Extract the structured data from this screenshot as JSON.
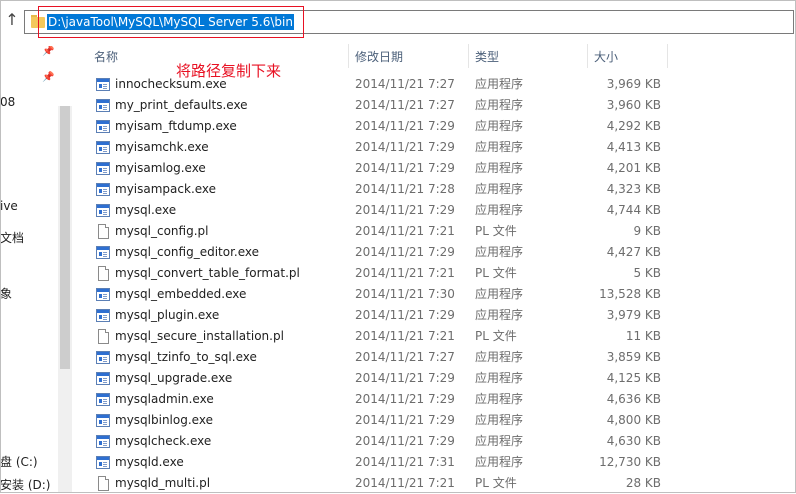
{
  "address_bar": {
    "path": "D:\\javaTool\\MySQL\\MySQL Server 5.6\\bin"
  },
  "annotation": {
    "text": "将路径复制下来",
    "color": "#e81123"
  },
  "nav_pane": {
    "items": [
      {
        "label": "08"
      },
      {
        "label": "ive"
      },
      {
        "label": "文档"
      },
      {
        "label": "象"
      },
      {
        "label": "盘 (C:)"
      },
      {
        "label": "安装 (D:)"
      }
    ]
  },
  "columns": {
    "name": "名称",
    "date": "修改日期",
    "type": "类型",
    "size": "大小"
  },
  "files": [
    {
      "name": "innochecksum.exe",
      "date": "2014/11/21 7:27",
      "type": "应用程序",
      "size": "3,969 KB",
      "icon": "exe-icon"
    },
    {
      "name": "my_print_defaults.exe",
      "date": "2014/11/21 7:27",
      "type": "应用程序",
      "size": "3,960 KB",
      "icon": "exe-icon"
    },
    {
      "name": "myisam_ftdump.exe",
      "date": "2014/11/21 7:29",
      "type": "应用程序",
      "size": "4,292 KB",
      "icon": "exe-icon"
    },
    {
      "name": "myisamchk.exe",
      "date": "2014/11/21 7:29",
      "type": "应用程序",
      "size": "4,413 KB",
      "icon": "exe-icon"
    },
    {
      "name": "myisamlog.exe",
      "date": "2014/11/21 7:29",
      "type": "应用程序",
      "size": "4,201 KB",
      "icon": "exe-icon"
    },
    {
      "name": "myisampack.exe",
      "date": "2014/11/21 7:28",
      "type": "应用程序",
      "size": "4,323 KB",
      "icon": "exe-icon"
    },
    {
      "name": "mysql.exe",
      "date": "2014/11/21 7:29",
      "type": "应用程序",
      "size": "4,744 KB",
      "icon": "exe-icon"
    },
    {
      "name": "mysql_config.pl",
      "date": "2014/11/21 7:21",
      "type": "PL 文件",
      "size": "9 KB",
      "icon": "document-icon"
    },
    {
      "name": "mysql_config_editor.exe",
      "date": "2014/11/21 7:29",
      "type": "应用程序",
      "size": "4,427 KB",
      "icon": "exe-icon"
    },
    {
      "name": "mysql_convert_table_format.pl",
      "date": "2014/11/21 7:21",
      "type": "PL 文件",
      "size": "5 KB",
      "icon": "document-icon"
    },
    {
      "name": "mysql_embedded.exe",
      "date": "2014/11/21 7:30",
      "type": "应用程序",
      "size": "13,528 KB",
      "icon": "exe-icon"
    },
    {
      "name": "mysql_plugin.exe",
      "date": "2014/11/21 7:29",
      "type": "应用程序",
      "size": "3,979 KB",
      "icon": "exe-icon"
    },
    {
      "name": "mysql_secure_installation.pl",
      "date": "2014/11/21 7:21",
      "type": "PL 文件",
      "size": "11 KB",
      "icon": "document-icon"
    },
    {
      "name": "mysql_tzinfo_to_sql.exe",
      "date": "2014/11/21 7:27",
      "type": "应用程序",
      "size": "3,859 KB",
      "icon": "exe-icon"
    },
    {
      "name": "mysql_upgrade.exe",
      "date": "2014/11/21 7:29",
      "type": "应用程序",
      "size": "4,125 KB",
      "icon": "exe-icon"
    },
    {
      "name": "mysqladmin.exe",
      "date": "2014/11/21 7:29",
      "type": "应用程序",
      "size": "4,636 KB",
      "icon": "exe-icon"
    },
    {
      "name": "mysqlbinlog.exe",
      "date": "2014/11/21 7:29",
      "type": "应用程序",
      "size": "4,800 KB",
      "icon": "exe-icon"
    },
    {
      "name": "mysqlcheck.exe",
      "date": "2014/11/21 7:29",
      "type": "应用程序",
      "size": "4,630 KB",
      "icon": "exe-icon"
    },
    {
      "name": "mysqld.exe",
      "date": "2014/11/21 7:31",
      "type": "应用程序",
      "size": "12,730 KB",
      "icon": "exe-icon"
    },
    {
      "name": "mysqld_multi.pl",
      "date": "2014/11/21 7:21",
      "type": "PL 文件",
      "size": "28 KB",
      "icon": "document-icon"
    }
  ],
  "colors": {
    "selection": "#0078d7",
    "header_text": "#4c607a",
    "annotation": "#e81123"
  }
}
